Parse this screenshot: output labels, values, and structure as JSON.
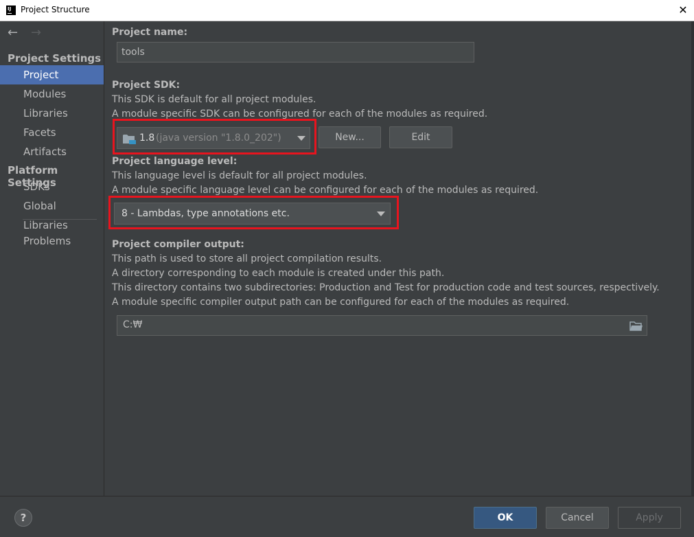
{
  "window": {
    "title": "Project Structure",
    "app_icon_text": "IJ"
  },
  "colors": {
    "background": "#3c3f41",
    "selection": "#4b6eaf",
    "primary_button": "#365880",
    "highlight_box": "#e8141e",
    "text": "#bbbbbb"
  },
  "sidebar": {
    "sections": [
      {
        "title": "Project Settings",
        "items": [
          "Project",
          "Modules",
          "Libraries",
          "Facets",
          "Artifacts"
        ]
      },
      {
        "title": "Platform Settings",
        "items": [
          "SDKs",
          "Global Libraries"
        ]
      }
    ],
    "extra_items": [
      "Problems"
    ],
    "selected": "Project",
    "icons": {
      "back": "arrow-left-icon",
      "forward": "arrow-right-icon"
    }
  },
  "project": {
    "name_label": "Project name:",
    "name_value": "tools",
    "sdk": {
      "label": "Project SDK:",
      "desc_lines": [
        "This SDK is default for all project modules.",
        "A module specific SDK can be configured for each of the modules as required."
      ],
      "selected_name": "1.8",
      "selected_detail": "(java version \"1.8.0_202\")",
      "new_button": "New...",
      "edit_button": "Edit"
    },
    "language_level": {
      "label": "Project language level:",
      "desc_lines": [
        "This language level is default for all project modules.",
        "A module specific language level can be configured for each of the modules as required."
      ],
      "selected": "8 - Lambdas, type annotations etc."
    },
    "compiler_output": {
      "label": "Project compiler output:",
      "desc_lines": [
        "This path is used to store all project compilation results.",
        "A directory corresponding to each module is created under this path.",
        "This directory contains two subdirectories: Production and Test for production code and test sources, respectively.",
        "A module specific compiler output path can be configured for each of the modules as required."
      ],
      "path_value": "C:₩"
    }
  },
  "footer": {
    "help": "?",
    "ok": "OK",
    "cancel": "Cancel",
    "apply": "Apply"
  }
}
